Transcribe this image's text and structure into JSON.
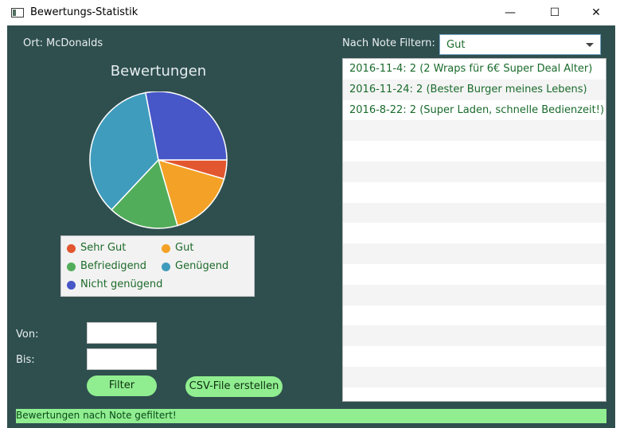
{
  "window": {
    "title": "Bewertungs-Statistik",
    "minimize": "—",
    "maximize": "☐",
    "close": "✕"
  },
  "ort": {
    "label": "Ort:",
    "value": "McDonalds"
  },
  "filter": {
    "label": "Nach Note Filtern:",
    "selected": "Gut"
  },
  "chart_data": {
    "type": "pie",
    "title": "Bewertungen",
    "slices": [
      {
        "name": "Sehr Gut",
        "value": 4.5,
        "color": "#e2572f"
      },
      {
        "name": "Gut",
        "value": 16,
        "color": "#f3a227"
      },
      {
        "name": "Befriedigend",
        "value": 16.5,
        "color": "#52ad5a"
      },
      {
        "name": "Genügend",
        "value": 35,
        "color": "#3f9cbd"
      },
      {
        "name": "Nicht genügend",
        "value": 28,
        "color": "#4757c7"
      }
    ]
  },
  "legend": [
    {
      "label": "Sehr Gut",
      "color": "#e2572f"
    },
    {
      "label": "Gut",
      "color": "#f3a227"
    },
    {
      "label": "Befriedigend",
      "color": "#52ad5a"
    },
    {
      "label": "Genügend",
      "color": "#3f9cbd"
    },
    {
      "label": "Nicht genügend",
      "color": "#4757c7"
    }
  ],
  "date_range": {
    "von_label": "Von:",
    "bis_label": "Bis:",
    "von_value": "",
    "bis_value": ""
  },
  "buttons": {
    "filter": "Filter",
    "csv": "CSV-File erstellen"
  },
  "reviews": [
    "2016-11-4: 2 (2 Wraps für 6€ Super Deal Alter)",
    "2016-11-24: 2 (Bester Burger meines Lebens)",
    "2016-8-22: 2 (Super Laden, schnelle Bedienzeit!)",
    "",
    "",
    "",
    "",
    "",
    "",
    "",
    "",
    "",
    "",
    "",
    "",
    "",
    ""
  ],
  "status": "Bewertungen nach Note gefiltert!"
}
